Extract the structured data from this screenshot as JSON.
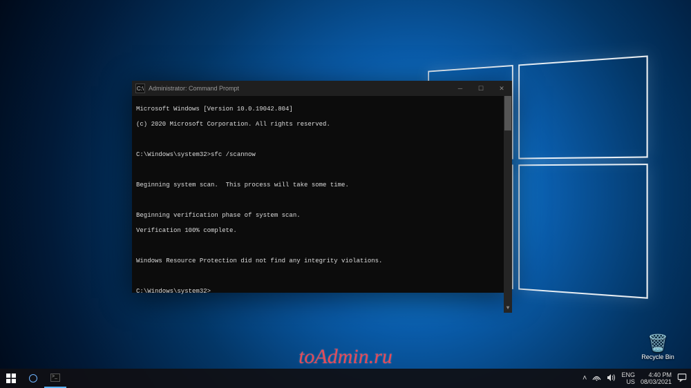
{
  "desktop": {
    "recycle_bin_label": "Recycle Bin",
    "watermark": "toAdmin.ru"
  },
  "cmd": {
    "title": "Administrator: Command Prompt",
    "icon_text": "C:\\",
    "lines": [
      "Microsoft Windows [Version 10.0.19042.804]",
      "(c) 2020 Microsoft Corporation. All rights reserved.",
      "",
      "C:\\Windows\\system32>sfc /scannow",
      "",
      "Beginning system scan.  This process will take some time.",
      "",
      "Beginning verification phase of system scan.",
      "Verification 100% complete.",
      "",
      "Windows Resource Protection did not find any integrity violations.",
      "",
      "C:\\Windows\\system32>"
    ]
  },
  "taskbar": {
    "start_tooltip": "Start"
  },
  "tray": {
    "lang_top": "ENG",
    "lang_bottom": "US",
    "time": "4:40 PM",
    "date": "08/03/2021"
  }
}
